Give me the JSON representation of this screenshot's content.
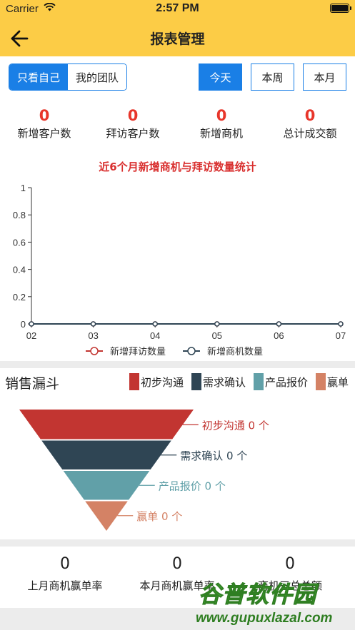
{
  "status_bar": {
    "carrier": "Carrier",
    "time": "2:57 PM"
  },
  "nav": {
    "title": "报表管理",
    "back_icon": "back-arrow-icon"
  },
  "scope_tabs": [
    {
      "label": "只看自己",
      "selected": true
    },
    {
      "label": "我的团队",
      "selected": false
    }
  ],
  "period_buttons": [
    {
      "label": "今天",
      "selected": true
    },
    {
      "label": "本周",
      "selected": false
    },
    {
      "label": "本月",
      "selected": false
    }
  ],
  "stats": [
    {
      "value": "0",
      "label": "新增客户数"
    },
    {
      "value": "0",
      "label": "拜访客户数"
    },
    {
      "value": "0",
      "label": "新增商机"
    },
    {
      "value": "0",
      "label": "总计成交额"
    }
  ],
  "colors": {
    "accent": "#1a7fe6",
    "header": "#fccc46",
    "stat_number": "#e8362b",
    "chart_title": "#d9302f",
    "series_visits": "#c23531",
    "series_opps": "#2f4554",
    "funnel": [
      "#c23531",
      "#2f4554",
      "#61a0a8",
      "#d48265"
    ]
  },
  "chart_data": [
    {
      "type": "line",
      "title": "近6个月新增商机与拜访数量统计",
      "categories": [
        "02",
        "03",
        "04",
        "05",
        "06",
        "07"
      ],
      "series": [
        {
          "name": "新增拜访数量",
          "values": [
            0,
            0,
            0,
            0,
            0,
            0
          ]
        },
        {
          "name": "新增商机数量",
          "values": [
            0,
            0,
            0,
            0,
            0,
            0
          ]
        }
      ],
      "ylim": [
        0,
        1
      ],
      "yticks": [
        "0",
        "0.2",
        "0.4",
        "0.6",
        "0.8",
        "1"
      ],
      "grid": false,
      "legend": "bottom"
    },
    {
      "type": "funnel",
      "title": "销售漏斗",
      "legend": "top-right",
      "stages": [
        {
          "name": "初步沟通",
          "label": "初步沟通 0 个",
          "value": 0
        },
        {
          "name": "需求确认",
          "label": "需求确认 0 个",
          "value": 0
        },
        {
          "name": "产品报价",
          "label": "产品报价 0 个",
          "value": 0
        },
        {
          "name": "赢单",
          "label": "赢单 0 个",
          "value": 0
        }
      ]
    }
  ],
  "funnel_section": {
    "title": "销售漏斗",
    "legend": [
      "初步沟通",
      "需求确认",
      "产品报价",
      "赢单"
    ]
  },
  "bottom_stats": [
    {
      "value": "0",
      "label": "上月商机赢单率"
    },
    {
      "value": "0",
      "label": "本月商机赢单率"
    },
    {
      "value": "0",
      "label": "商机三总总额"
    }
  ],
  "watermark": {
    "text": "谷普软件园",
    "url": "www.gupuxlazal.com"
  }
}
